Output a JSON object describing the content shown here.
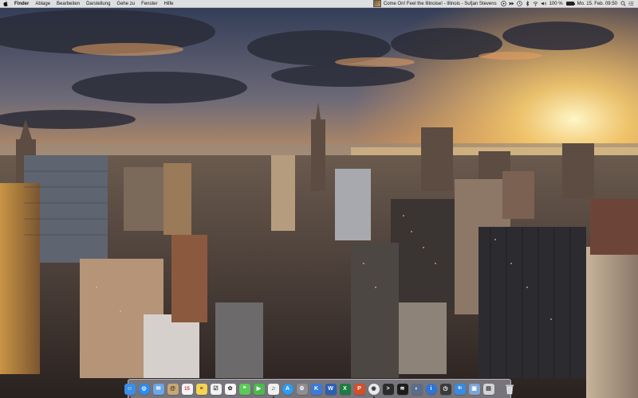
{
  "menubar": {
    "apple_icon": "apple-logo-icon",
    "app_name": "Finder",
    "menus": [
      "Ablage",
      "Bearbeiten",
      "Darstellung",
      "Gehe zu",
      "Fenster",
      "Hilfe"
    ],
    "now_playing": "Come On! Feel the Illinoise! - Illinois - Sufjan Stevens",
    "battery_percent": "100 %",
    "battery_level": 1.0,
    "clock": "Mo. 15. Feb.  09:50",
    "status_icons": [
      "play-icon",
      "forward-icon",
      "clock-icon",
      "bluetooth-icon",
      "wifi-icon",
      "volume-icon"
    ],
    "trailing_icons": [
      "search-icon",
      "list-icon"
    ]
  },
  "wallpaper": {
    "description_icon": "new-york-skyline-sunset"
  },
  "dock": {
    "apps": [
      {
        "name": "finder",
        "color": "#3a8ee6",
        "glyph": "☺",
        "running": true
      },
      {
        "name": "safari",
        "color": "#2d8cf0",
        "glyph": "◎",
        "running": false
      },
      {
        "name": "mail",
        "color": "#6aa7e8",
        "glyph": "✉",
        "running": false
      },
      {
        "name": "contacts",
        "color": "#c9a774",
        "glyph": "@",
        "running": false
      },
      {
        "name": "calendar",
        "color": "#f4f4f4",
        "glyph": "15",
        "running": false
      },
      {
        "name": "notes",
        "color": "#f7d553",
        "glyph": "≡",
        "running": false
      },
      {
        "name": "reminders",
        "color": "#f2f2f2",
        "glyph": "☑",
        "running": false
      },
      {
        "name": "photos",
        "color": "#f7f7f7",
        "glyph": "✿",
        "running": false
      },
      {
        "name": "messages",
        "color": "#5cc85a",
        "glyph": "❝",
        "running": false
      },
      {
        "name": "facetime",
        "color": "#4cba4e",
        "glyph": "▶",
        "running": false
      },
      {
        "name": "itunes",
        "color": "#f0f0f0",
        "glyph": "♫",
        "running": true
      },
      {
        "name": "app-store",
        "color": "#2f9bf0",
        "glyph": "A",
        "running": false
      },
      {
        "name": "system-preferences",
        "color": "#8e8e93",
        "glyph": "⚙",
        "running": false
      },
      {
        "name": "keynote",
        "color": "#3b7ad8",
        "glyph": "K",
        "running": false
      },
      {
        "name": "word",
        "color": "#2b5fb4",
        "glyph": "W",
        "running": false
      },
      {
        "name": "excel",
        "color": "#1f7a42",
        "glyph": "X",
        "running": false
      },
      {
        "name": "powerpoint",
        "color": "#d2502a",
        "glyph": "P",
        "running": false
      },
      {
        "name": "chrome",
        "color": "#e9e9e9",
        "glyph": "◉",
        "running": true
      },
      {
        "name": "terminal",
        "color": "#2b2b2b",
        "glyph": ">",
        "running": false
      },
      {
        "name": "spotify",
        "color": "#1c1c1c",
        "glyph": "≋",
        "running": false
      },
      {
        "name": "instruments",
        "color": "#5a6e8a",
        "glyph": "◐",
        "running": false
      },
      {
        "name": "info",
        "color": "#2f75d6",
        "glyph": "i",
        "running": false
      },
      {
        "name": "dashboard",
        "color": "#3b3b3b",
        "glyph": "◷",
        "running": false
      },
      {
        "name": "fii",
        "color": "#3a8ae0",
        "glyph": "fii",
        "running": false
      },
      {
        "name": "preview",
        "color": "#7da5d4",
        "glyph": "▣",
        "running": false
      },
      {
        "name": "downloads",
        "color": "#d4d4d8",
        "glyph": "▤",
        "running": false
      }
    ],
    "trash_icon": "trash-icon"
  }
}
